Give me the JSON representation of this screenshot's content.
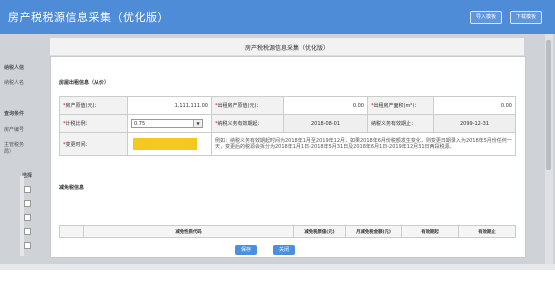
{
  "banner": {
    "title": "房产税税源信息采集（优化版）",
    "import_label": "导入模板",
    "download_label": "下载模板"
  },
  "background": {
    "label_1": "纳税人信",
    "label_2": "纳税人名",
    "label_3": "查询条件",
    "label_4": "房产编号",
    "label_5": "主管税务",
    "label_6": "局）",
    "label_7": "选择"
  },
  "dialog": {
    "title": "房产税税源信息采集（优化版）",
    "section_rental": "房屋出租信息（从价）",
    "section_reduce": "减免税信息",
    "fields": {
      "original_value_label": "房产原值(元)：",
      "original_value": "1,111,111.00",
      "rent_original_value_label": "出租房产原值(元)：",
      "rent_original_value": "0.00",
      "rent_area_label": "出租房产面积(m²)：",
      "rent_area": "0.00",
      "tax_ratio_label": "计税比例：",
      "tax_ratio": "0.75",
      "obligation_start_label": "纳税义务有效期起：",
      "obligation_start": "2018-08-01",
      "obligation_end_label": "纳税义务有效期止：",
      "obligation_end": "2099-12-31",
      "change_time_label": "变更时间：",
      "note": "例如：纳税义务有效期起时间为2018年1月至2019年12月，如果2018年6月份税额发生变化，则变更日期录入为2018年5月份任何一天，变更后的税源会拆分为2018年1月1日-2018年5月31日及2018年6月1日-2019年12月31日两段税源。"
    },
    "reduce_columns": [
      "减免性质代码",
      "减免税原值(元)",
      "月减免税金额(元)",
      "有效期起",
      "有效期止"
    ],
    "save_label": "保存",
    "close_label": "关闭"
  }
}
